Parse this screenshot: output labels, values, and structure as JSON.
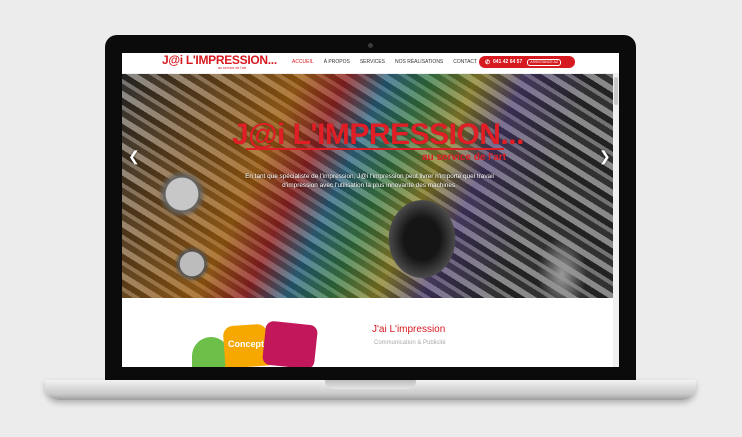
{
  "header": {
    "logo_text": "J@i L'IMPRESSION...",
    "logo_sub": "au service de l'art",
    "nav": [
      {
        "label": "ACCUEIL",
        "active": true
      },
      {
        "label": "À PROPOS",
        "active": false
      },
      {
        "label": "SERVICES",
        "active": false
      },
      {
        "label": "NOS RÉALISATIONS",
        "active": false
      },
      {
        "label": "CONTACT",
        "active": false
      }
    ],
    "phone": "041 42 64 57",
    "assist_label": "ASSISTANCE AZ"
  },
  "hero": {
    "logo_text": "J@i L'IMPRESSION...",
    "subtitle": "au service de l'art",
    "description_line1": "En tant que spécialiste de l'impression, J@i l'impression peut livrer n'importe quel travail",
    "description_line2": "d'impression avec l'utilisation la plus innovante des machines.",
    "prev_icon": "chevron-left-icon",
    "next_icon": "chevron-right-icon"
  },
  "about": {
    "concept_label": "Concept",
    "title": "J'ai L'impression",
    "subtitle": "Communication & Publicité"
  },
  "colors": {
    "brand_red": "#d71920",
    "green": "#6cc04a",
    "orange": "#f7a800",
    "pink": "#c2185b"
  }
}
